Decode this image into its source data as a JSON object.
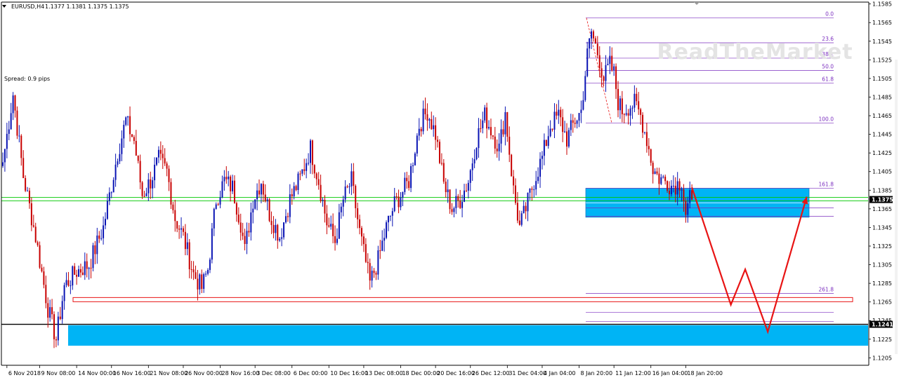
{
  "header": {
    "symbol": "EURUSD,H4",
    "ohlc": "1.1377 1.1381 1.1375 1.1375",
    "spread": "Spread: 0.9 pips"
  },
  "watermark": "ReadTheMarket",
  "colors": {
    "bull": "#0a14b4",
    "bear": "#c80000",
    "zone": "#00b4f5",
    "fib": "#7b2fbf",
    "bid": "#00c800",
    "arrow": "#e81414"
  },
  "chart_data": {
    "type": "candlestick",
    "symbol": "EURUSD",
    "timeframe": "H4",
    "ylim": [
      1.1197,
      1.1587
    ],
    "price_ticks": [
      "1.1585",
      "1.1565",
      "1.1545",
      "1.1525",
      "1.1505",
      "1.1485",
      "1.1465",
      "1.1445",
      "1.1425",
      "1.1405",
      "1.1385",
      "1.1365",
      "1.1345",
      "1.1325",
      "1.1305",
      "1.1285",
      "1.1265",
      "1.1245",
      "1.1225",
      "1.1205"
    ],
    "time_labels": [
      {
        "label": "6 Nov 2018",
        "i": 2
      },
      {
        "label": "9 Nov 08:00",
        "i": 18
      },
      {
        "label": "14 Nov 00:00",
        "i": 36
      },
      {
        "label": "16 Nov 16:00",
        "i": 53
      },
      {
        "label": "21 Nov 08:00",
        "i": 71
      },
      {
        "label": "26 Nov 00:00",
        "i": 88
      },
      {
        "label": "28 Nov 16:00",
        "i": 106
      },
      {
        "label": "3 Dec 08:00",
        "i": 123
      },
      {
        "label": "6 Dec 00:00",
        "i": 141
      },
      {
        "label": "10 Dec 16:00",
        "i": 159
      },
      {
        "label": "13 Dec 08:00",
        "i": 176
      },
      {
        "label": "18 Dec 00:00",
        "i": 194
      },
      {
        "label": "20 Dec 16:00",
        "i": 211
      },
      {
        "label": "26 Dec 12:00",
        "i": 228
      },
      {
        "label": "31 Dec 04:00",
        "i": 246
      },
      {
        "label": "4 Jan 04:00",
        "i": 263
      },
      {
        "label": "8 Jan 20:00",
        "i": 281
      },
      {
        "label": "11 Jan 12:00",
        "i": 298
      },
      {
        "label": "16 Jan 04:00",
        "i": 316
      },
      {
        "label": "18 Jan 20:00",
        "i": 333
      }
    ],
    "path": [
      [
        0,
        1.1415
      ],
      [
        5,
        1.1488
      ],
      [
        10,
        1.14
      ],
      [
        16,
        1.1335
      ],
      [
        22,
        1.1258
      ],
      [
        26,
        1.1225
      ],
      [
        30,
        1.1282
      ],
      [
        36,
        1.1298
      ],
      [
        42,
        1.1305
      ],
      [
        49,
        1.1345
      ],
      [
        56,
        1.1425
      ],
      [
        60,
        1.146
      ],
      [
        64,
        1.1438
      ],
      [
        68,
        1.138
      ],
      [
        72,
        1.1395
      ],
      [
        76,
        1.1418
      ],
      [
        80,
        1.1405
      ],
      [
        84,
        1.1355
      ],
      [
        88,
        1.1335
      ],
      [
        93,
        1.1295
      ],
      [
        97,
        1.128
      ],
      [
        100,
        1.13
      ],
      [
        104,
        1.1375
      ],
      [
        108,
        1.1395
      ],
      [
        112,
        1.1388
      ],
      [
        116,
        1.135
      ],
      [
        118,
        1.132
      ],
      [
        122,
        1.1375
      ],
      [
        126,
        1.1395
      ],
      [
        130,
        1.136
      ],
      [
        135,
        1.1335
      ],
      [
        140,
        1.1375
      ],
      [
        145,
        1.1398
      ],
      [
        150,
        1.143
      ],
      [
        154,
        1.1395
      ],
      [
        158,
        1.135
      ],
      [
        162,
        1.133
      ],
      [
        166,
        1.1375
      ],
      [
        170,
        1.1395
      ],
      [
        174,
        1.134
      ],
      [
        179,
        1.1285
      ],
      [
        183,
        1.131
      ],
      [
        187,
        1.1345
      ],
      [
        191,
        1.137
      ],
      [
        194,
        1.138
      ],
      [
        198,
        1.1395
      ],
      [
        203,
        1.1455
      ],
      [
        207,
        1.147
      ],
      [
        211,
        1.1445
      ],
      [
        215,
        1.1392
      ],
      [
        219,
        1.1365
      ],
      [
        223,
        1.1375
      ],
      [
        227,
        1.1395
      ],
      [
        231,
        1.144
      ],
      [
        235,
        1.1465
      ],
      [
        239,
        1.1445
      ],
      [
        242,
        1.143
      ],
      [
        245,
        1.1468
      ],
      [
        249,
        1.1385
      ],
      [
        252,
        1.1345
      ],
      [
        255,
        1.1365
      ],
      [
        259,
        1.1395
      ],
      [
        263,
        1.142
      ],
      [
        267,
        1.1455
      ],
      [
        271,
        1.1465
      ],
      [
        275,
        1.144
      ],
      [
        279,
        1.146
      ],
      [
        282,
        1.147
      ],
      [
        285,
        1.153
      ],
      [
        287,
        1.1555
      ],
      [
        289,
        1.154
      ],
      [
        291,
        1.1525
      ],
      [
        293,
        1.1505
      ],
      [
        296,
        1.152
      ],
      [
        298,
        1.151
      ],
      [
        300,
        1.148
      ],
      [
        302,
        1.147
      ],
      [
        305,
        1.1475
      ],
      [
        308,
        1.1478
      ],
      [
        311,
        1.1465
      ],
      [
        314,
        1.144
      ],
      [
        317,
        1.1408
      ],
      [
        320,
        1.1398
      ],
      [
        323,
        1.1395
      ],
      [
        326,
        1.139
      ],
      [
        329,
        1.1392
      ],
      [
        331,
        1.1395
      ],
      [
        333,
        1.136
      ],
      [
        335,
        1.1375
      ],
      [
        336,
        1.1375
      ]
    ],
    "seed": 7,
    "current_bid": "1.1375",
    "black_level": "1.1241",
    "demand_zone_upper": {
      "top": 1.1387,
      "bottom": 1.1356
    },
    "demand_zone_lower": {
      "top": 1.124,
      "bottom": 1.1218
    },
    "support_box": {
      "top": 1.1269,
      "bottom": 1.1266
    },
    "fibonacci": {
      "level_0": 1.157,
      "level_100": 1.1457,
      "levels": [
        {
          "label": "0.0",
          "value": 0
        },
        {
          "label": "23.6",
          "value": 23.6
        },
        {
          "label": "38.2",
          "value": 38.2
        },
        {
          "label": "50.0",
          "value": 50.0
        },
        {
          "label": "61.8",
          "value": 61.8
        },
        {
          "label": "100.0",
          "value": 100
        },
        {
          "label": "161.8",
          "value": 161.8
        },
        {
          "label": "261.8",
          "value": 261.8
        }
      ],
      "extra_values": [
        1.1366,
        1.1357,
        1.1254,
        1.1244
      ]
    },
    "projection_arrow": [
      [
        336,
        1.1388
      ],
      [
        355,
        1.1262
      ],
      [
        362,
        1.13
      ],
      [
        373,
        1.1233
      ],
      [
        392,
        1.1378
      ]
    ]
  }
}
